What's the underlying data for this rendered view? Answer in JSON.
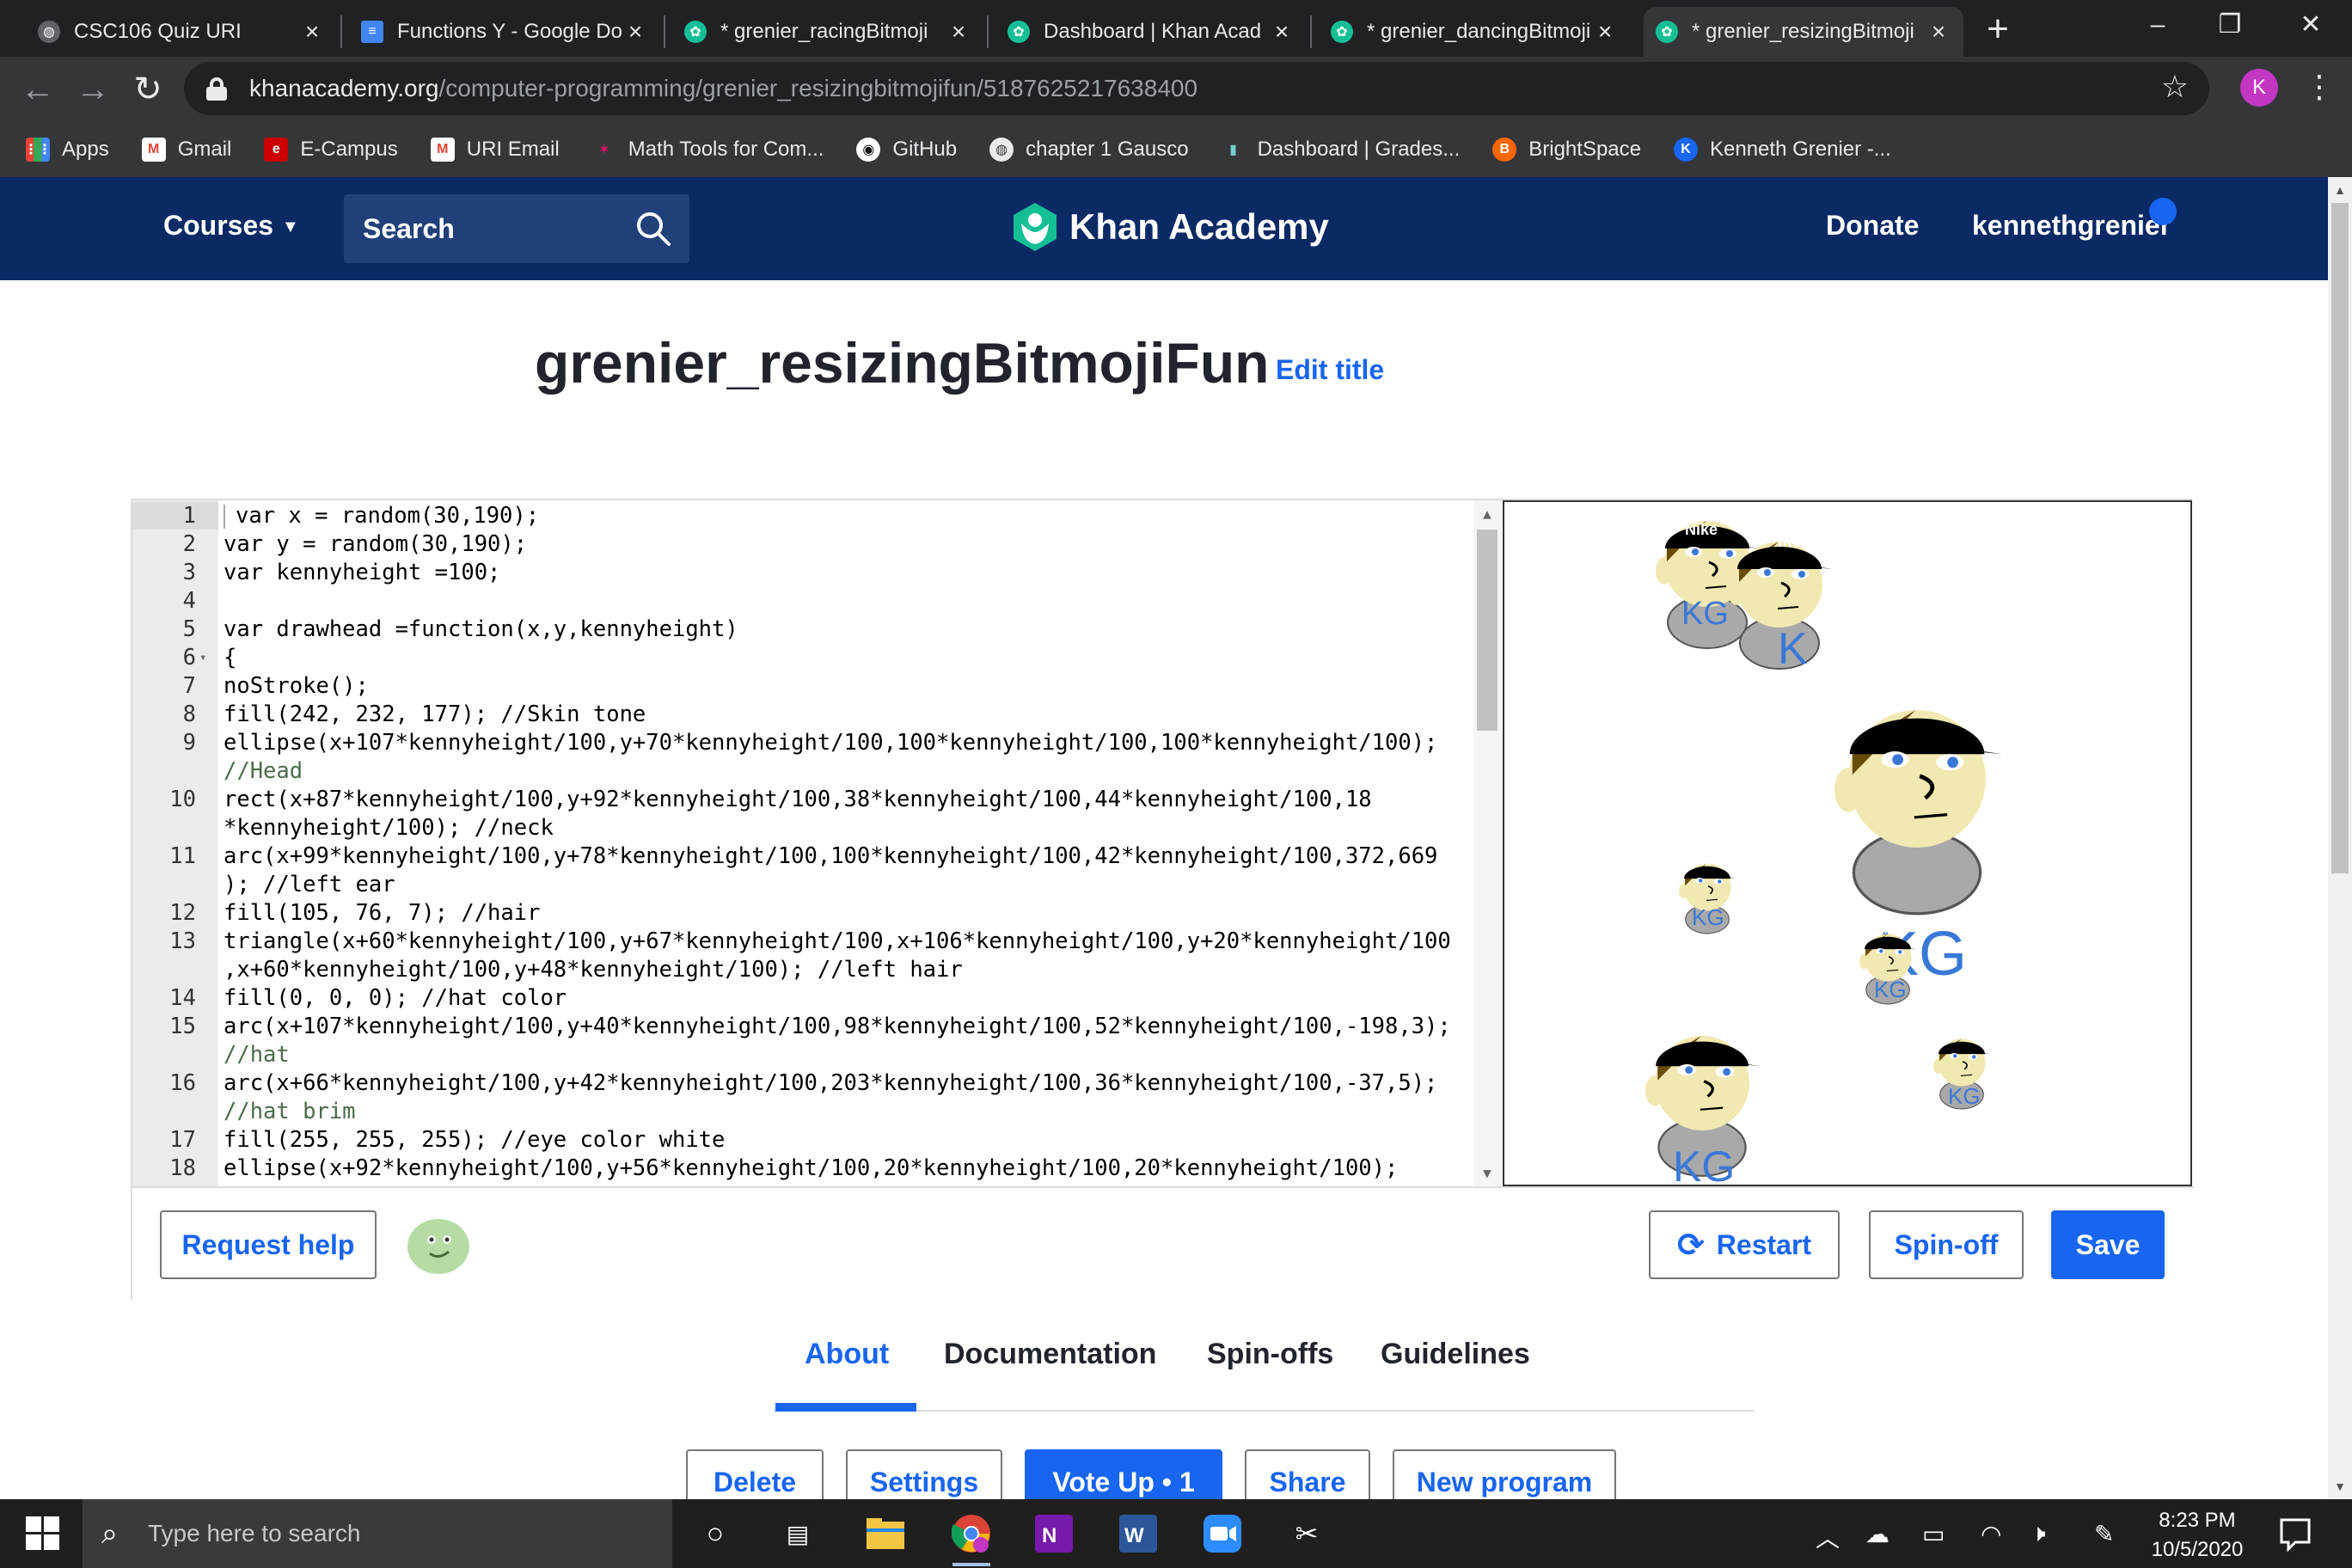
{
  "browser": {
    "tabs": [
      {
        "title": "CSC106 Quiz URI",
        "favicon": "globe-icon"
      },
      {
        "title": "Functions Y - Google Do",
        "favicon": "google-docs-icon"
      },
      {
        "title": "* grenier_racingBitmoji",
        "favicon": "khan-academy-icon"
      },
      {
        "title": "Dashboard | Khan Acad",
        "favicon": "khan-academy-icon"
      },
      {
        "title": "* grenier_dancingBitmoji",
        "favicon": "khan-academy-icon"
      },
      {
        "title": "* grenier_resizingBitmoji",
        "favicon": "khan-academy-icon",
        "active": true
      }
    ],
    "url_host": "khanacademy.org",
    "url_path": "/computer-programming/grenier_resizingbitmojifun/5187625217638400",
    "profile_initial": "K",
    "bookmarks": [
      "Apps",
      "Gmail",
      "E-Campus",
      "URI Email",
      "Math Tools for Com...",
      "GitHub",
      "chapter 1 Gausco",
      "Dashboard | Grades...",
      "BrightSpace",
      "Kenneth Grenier -..."
    ]
  },
  "khan": {
    "courses_label": "Courses",
    "search_label": "Search",
    "brand": "Khan Academy",
    "donate_label": "Donate",
    "username": "kennethgrenier",
    "brand_color": "#0a2a66",
    "accent_color": "#1865f2"
  },
  "program": {
    "title": "grenier_resizingBitmojiFun",
    "edit_title_label": "Edit title",
    "line_numbers": [
      "1",
      "2",
      "3",
      "4",
      "5",
      "6",
      "7",
      "8",
      "9",
      "10",
      "11",
      "12",
      "13",
      "14",
      "15",
      "16",
      "17",
      "18"
    ],
    "code_lines": [
      "var x = random(30,190);",
      "var y = random(30,190);",
      "var kennyheight =100;",
      "",
      "var drawhead =function(x,y,kennyheight)",
      "{",
      "noStroke();",
      "fill(242, 232, 177); //Skin tone",
      "ellipse(x+107*kennyheight/100,y+70*kennyheight/100,100*kennyheight/100,100*kennyheight/100);",
      "//Head",
      "rect(x+87*kennyheight/100,y+92*kennyheight/100,38*kennyheight/100,44*kennyheight/100,18",
      "*kennyheight/100); //neck",
      "arc(x+99*kennyheight/100,y+78*kennyheight/100,100*kennyheight/100,42*kennyheight/100,372,669",
      "); //left ear",
      "fill(105, 76, 7); //hair",
      "triangle(x+60*kennyheight/100,y+67*kennyheight/100,x+106*kennyheight/100,y+20*kennyheight/100",
      ",x+60*kennyheight/100,y+48*kennyheight/100); //left hair",
      "fill(0, 0, 0); //hat color",
      "arc(x+107*kennyheight/100,y+40*kennyheight/100,98*kennyheight/100,52*kennyheight/100,-198,3);",
      "//hat",
      "arc(x+66*kennyheight/100,y+42*kennyheight/100,203*kennyheight/100,36*kennyheight/100,-37,5);",
      "//hat brim",
      "fill(255, 255, 255); //eye color white",
      "ellipse(x+92*kennyheight/100,y+56*kennyheight/100,20*kennyheight/100,20*kennyheight/100);"
    ],
    "canvas_texts": {
      "hat_label": "Nike",
      "shirt_label": "KG",
      "partial_hat_label": "ike",
      "partial_shirt_label": "K",
      "large_shirt_label": "KG"
    },
    "buttons": {
      "request_help": "Request help",
      "restart": "Restart",
      "spinoff": "Spin-off",
      "save": "Save"
    },
    "lower_tabs": [
      "About",
      "Documentation",
      "Spin-offs",
      "Guidelines"
    ],
    "actions": [
      "Delete",
      "Settings",
      "Vote Up • 1",
      "Share",
      "New program"
    ]
  },
  "taskbar": {
    "search_placeholder": "Type here to search",
    "time": "8:23 PM",
    "date": "10/5/2020"
  }
}
